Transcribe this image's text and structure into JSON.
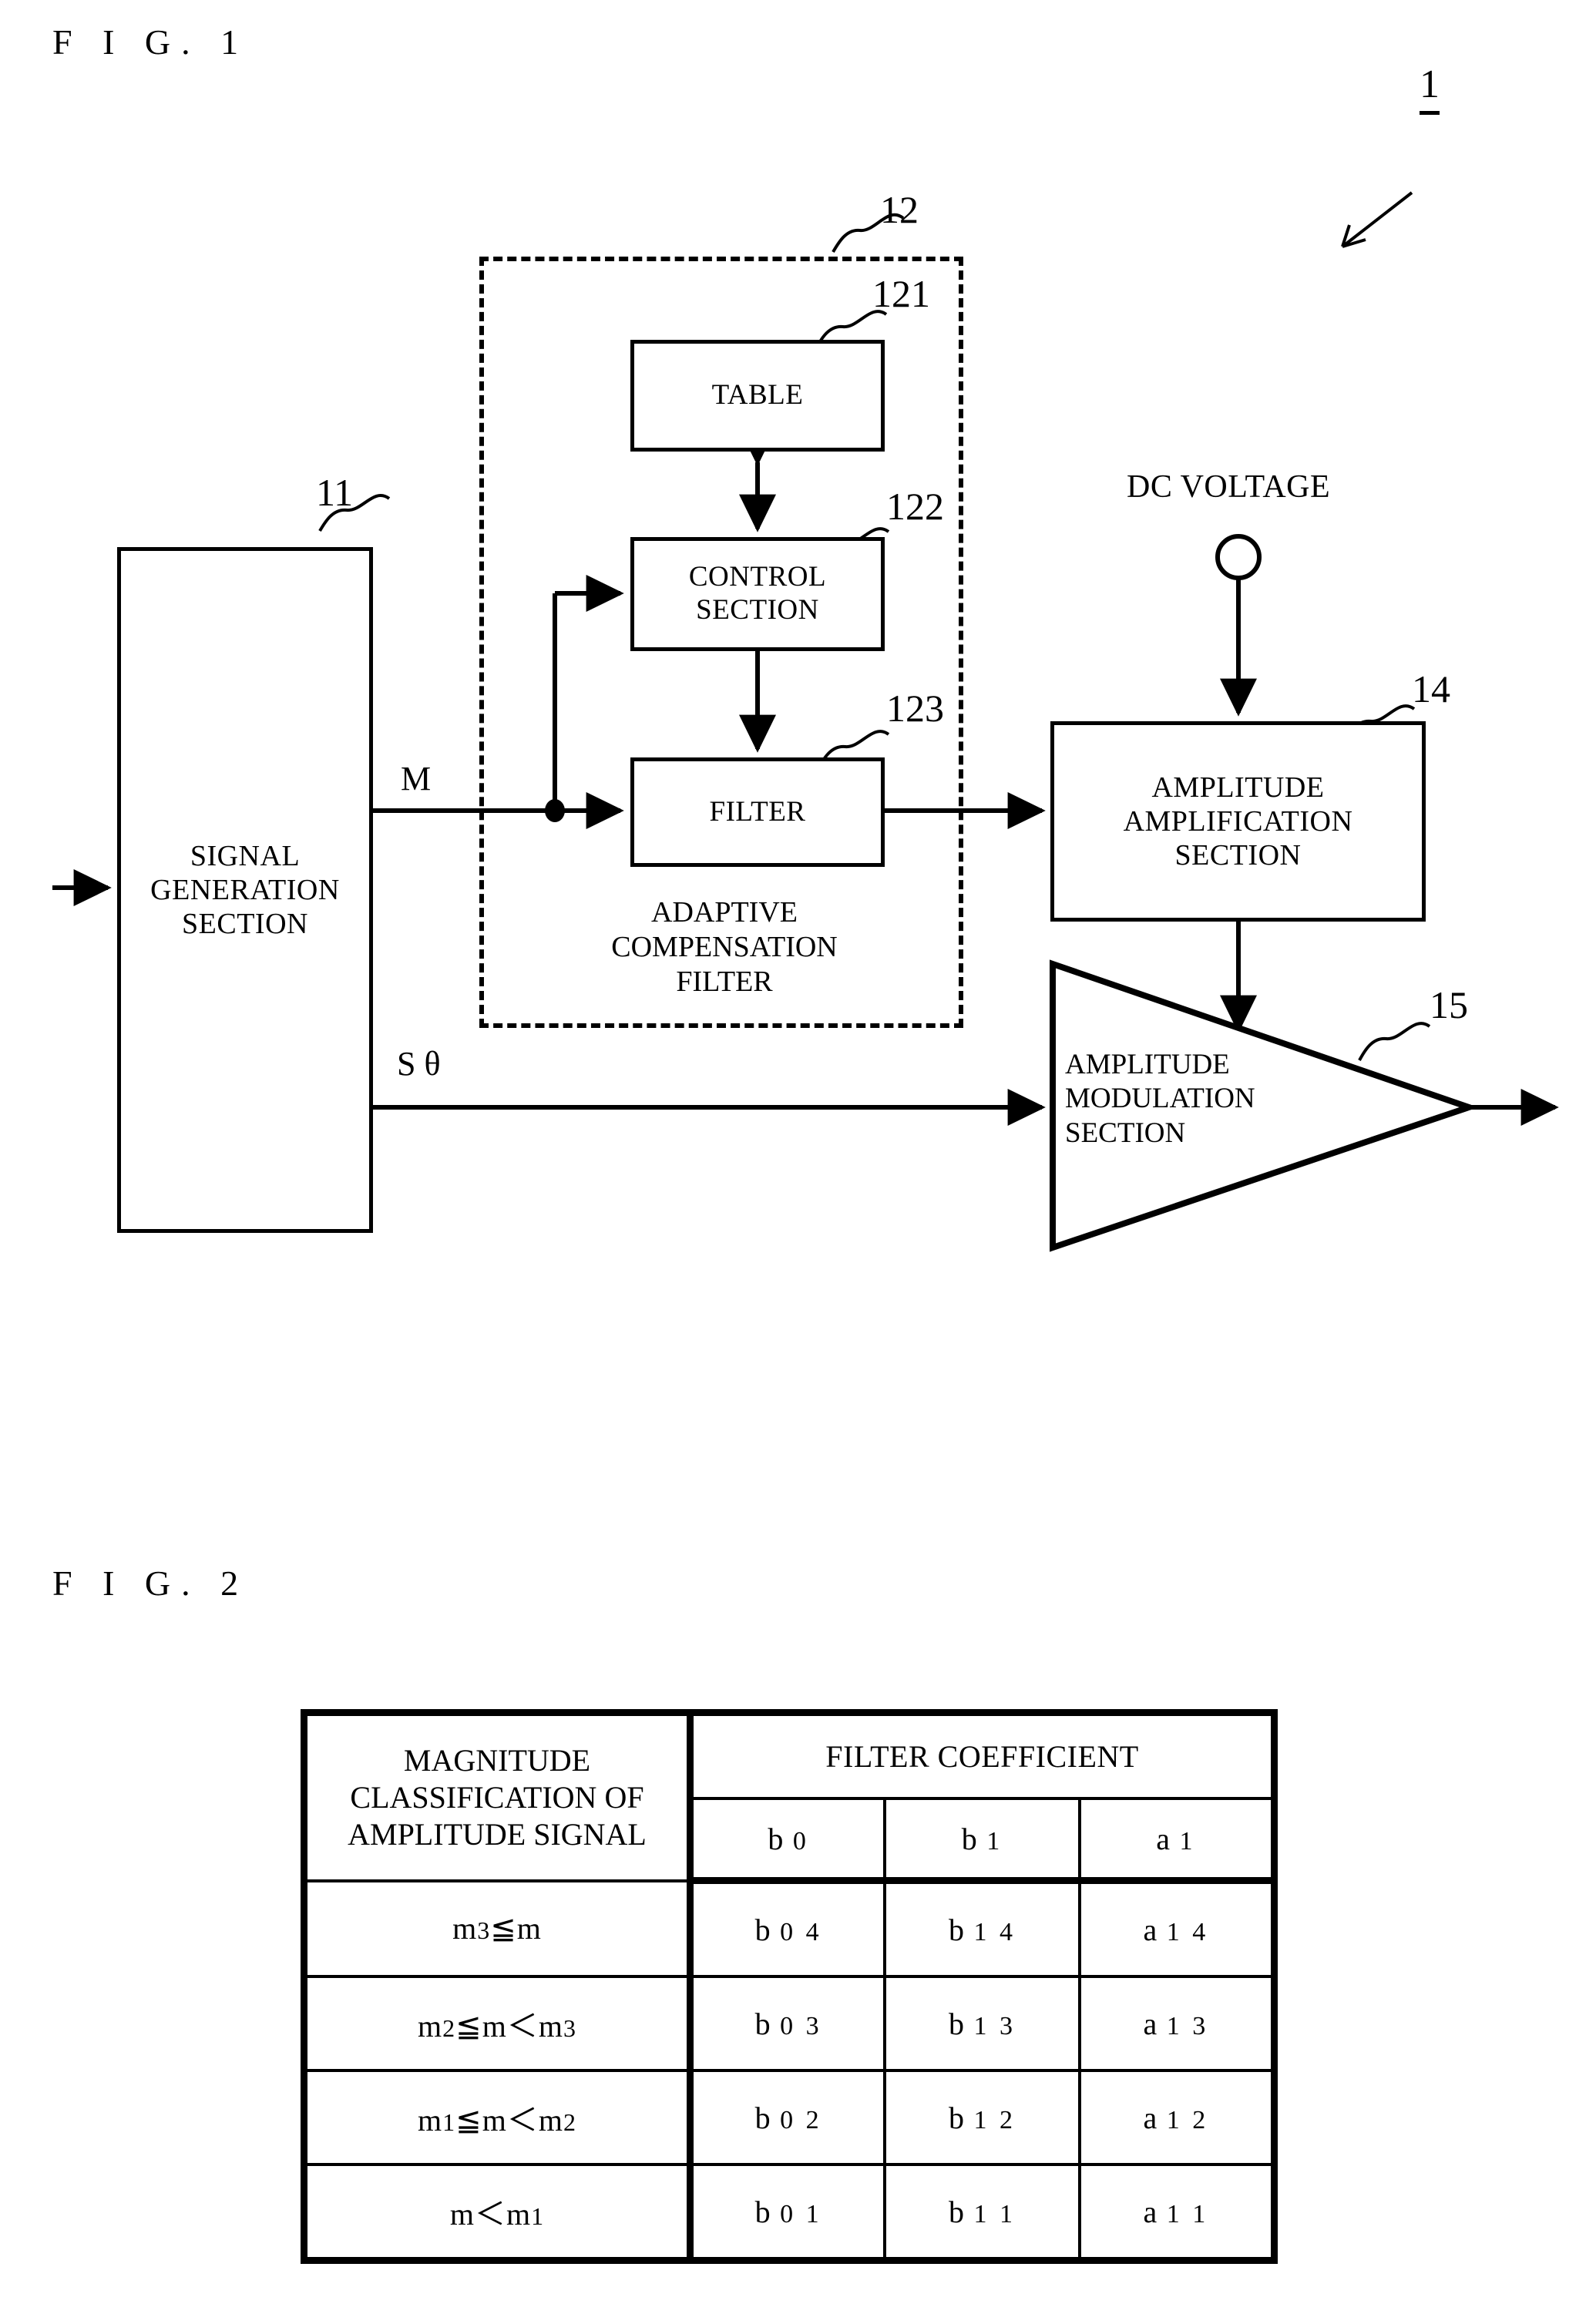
{
  "figures": {
    "fig1": {
      "caption": "F I G. 1",
      "system_ref": "1",
      "blocks": {
        "signal_generation": {
          "label": "SIGNAL\nGENERATION\nSECTION",
          "ref": "11"
        },
        "adaptive_filter_group": {
          "label": "ADAPTIVE\nCOMPENSATION\nFILTER",
          "ref": "12"
        },
        "table": {
          "label": "TABLE",
          "ref": "121"
        },
        "control_section": {
          "label": "CONTROL\nSECTION",
          "ref": "122"
        },
        "filter": {
          "label": "FILTER",
          "ref": "123"
        },
        "amplitude_amplification": {
          "label": "AMPLITUDE\nAMPLIFICATION\nSECTION",
          "ref": "14"
        },
        "amplitude_modulation": {
          "label": "AMPLITUDE\nMODULATION\nSECTION",
          "ref": "15"
        }
      },
      "signals": {
        "m": "M",
        "s_theta": "S θ",
        "dc_voltage": "DC VOLTAGE"
      }
    },
    "fig2": {
      "caption": "F I G. 2",
      "table": {
        "header_classification": "MAGNITUDE\nCLASSIFICATION OF\nAMPLITUDE SIGNAL",
        "header_coefficient": "FILTER COEFFICIENT",
        "coef_columns": [
          {
            "base": "b",
            "sub": "0"
          },
          {
            "base": "b",
            "sub": "1"
          },
          {
            "base": "a",
            "sub": "1"
          }
        ],
        "rows": [
          {
            "condition": "m₃≦m",
            "condition_parts": [
              {
                "t": "m",
                "s": "3"
              },
              {
                "t": "≦",
                "s": ""
              },
              {
                "t": "m",
                "s": ""
              }
            ],
            "values": [
              {
                "base": "b",
                "sub": "0 4"
              },
              {
                "base": "b",
                "sub": "1 4"
              },
              {
                "base": "a",
                "sub": "1 4"
              }
            ]
          },
          {
            "condition": "m₂≦m＜m₃",
            "condition_parts": [
              {
                "t": "m",
                "s": "2"
              },
              {
                "t": "≦",
                "s": ""
              },
              {
                "t": "m",
                "s": ""
              },
              {
                "t": "＜",
                "s": ""
              },
              {
                "t": "m",
                "s": "3"
              }
            ],
            "values": [
              {
                "base": "b",
                "sub": "0 3"
              },
              {
                "base": "b",
                "sub": "1 3"
              },
              {
                "base": "a",
                "sub": "1 3"
              }
            ]
          },
          {
            "condition": "m₁≦m＜m₂",
            "condition_parts": [
              {
                "t": "m",
                "s": "1"
              },
              {
                "t": "≦",
                "s": ""
              },
              {
                "t": "m",
                "s": ""
              },
              {
                "t": "＜",
                "s": ""
              },
              {
                "t": "m",
                "s": "2"
              }
            ],
            "values": [
              {
                "base": "b",
                "sub": "0 2"
              },
              {
                "base": "b",
                "sub": "1 2"
              },
              {
                "base": "a",
                "sub": "1 2"
              }
            ]
          },
          {
            "condition": "m＜m₁",
            "condition_parts": [
              {
                "t": "m",
                "s": ""
              },
              {
                "t": "＜",
                "s": ""
              },
              {
                "t": "m",
                "s": "1"
              }
            ],
            "values": [
              {
                "base": "b",
                "sub": "0 1"
              },
              {
                "base": "b",
                "sub": "1 1"
              },
              {
                "base": "a",
                "sub": "1 1"
              }
            ]
          }
        ]
      }
    }
  },
  "colors": {
    "ink": "#000000",
    "paper": "#ffffff"
  }
}
